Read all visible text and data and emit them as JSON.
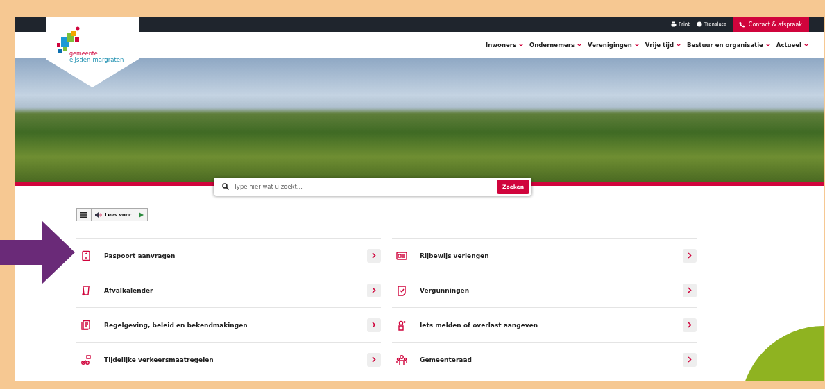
{
  "utility_bar": {
    "links": [
      {
        "kind": "print",
        "label": "Print"
      },
      {
        "kind": "translate",
        "label": "Translate"
      }
    ],
    "contact_button": "Contact & afspraak"
  },
  "logo": {
    "line1": "gemeente",
    "line2": "eijsden-margraten"
  },
  "nav": [
    {
      "label": "Inwoners"
    },
    {
      "label": "Ondernemers"
    },
    {
      "label": "Verenigingen"
    },
    {
      "label": "Vrije tijd"
    },
    {
      "label": "Bestuur en organisatie"
    },
    {
      "label": "Actueel"
    }
  ],
  "search": {
    "placeholder": "Type hier wat u zoekt...",
    "button": "Zoeken"
  },
  "read_aloud": {
    "label": "Lees voor"
  },
  "tasks": [
    {
      "label": "Paspoort aanvragen"
    },
    {
      "label": "Rijbewijs verlengen"
    },
    {
      "label": "Afvalkalender"
    },
    {
      "label": "Vergunningen"
    },
    {
      "label": "Regelgeving, beleid en bekendmakingen"
    },
    {
      "label": "Iets melden of overlast aangeven"
    },
    {
      "label": "Tijdelijke verkeersmaatregelen"
    },
    {
      "label": "Gemeenteraad"
    }
  ]
}
